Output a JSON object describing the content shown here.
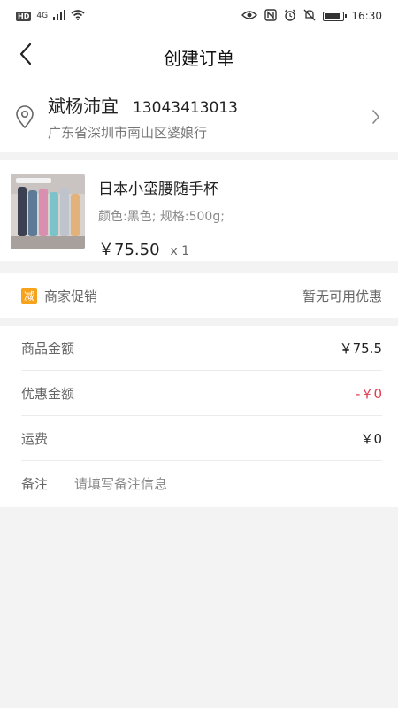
{
  "status_bar": {
    "hd": "HD",
    "signal": "4G",
    "time": "16:30",
    "battery_level": 0.85
  },
  "nav": {
    "title": "创建订单",
    "back_icon": "chevron-left-icon"
  },
  "address": {
    "name": "斌杨沛宜",
    "phone": "13043413013",
    "detail": "广东省深圳市南山区婆娘行"
  },
  "product": {
    "name": "日本小蛮腰随手杯",
    "spec": "颜色:黑色; 规格:500g;",
    "price": "￥75.50",
    "qty": "x 1"
  },
  "promotion": {
    "badge": "减",
    "label": "商家促销",
    "status": "暂无可用优惠"
  },
  "summary": {
    "goods_amount_label": "商品金额",
    "goods_amount_value": "￥75.5",
    "discount_label": "优惠金额",
    "discount_value": "-￥0",
    "shipping_label": "运费",
    "shipping_value": "￥0",
    "note_label": "备注",
    "note_placeholder": "请填写备注信息"
  },
  "colors": {
    "accent_red": "#e23b4a",
    "promo_orange": "#f7a21b"
  }
}
